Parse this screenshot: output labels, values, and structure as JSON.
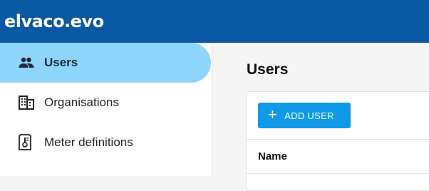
{
  "app": {
    "brand": "elvaco.evo"
  },
  "colors": {
    "topbar": "#0b58a2",
    "active_item": "#8dd5fb",
    "primary_button": "#0f9ae8"
  },
  "sidebar": {
    "items": [
      {
        "label": "Users",
        "icon": "users-icon",
        "active": true
      },
      {
        "label": "Organisations",
        "icon": "building-icon",
        "active": false
      },
      {
        "label": "Meter definitions",
        "icon": "meter-definition-icon",
        "active": false
      }
    ]
  },
  "main": {
    "title": "Users",
    "add_button_label": "ADD USER",
    "table": {
      "columns": [
        "Name"
      ]
    }
  }
}
